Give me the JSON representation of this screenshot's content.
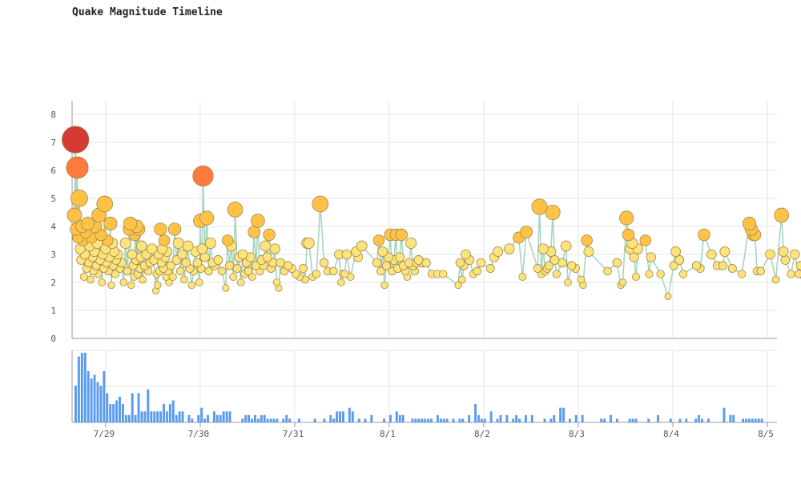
{
  "title": "Quake Magnitude Timeline",
  "colors": {
    "grid": "#e6e6e6",
    "axis": "#999999",
    "line": "#a8d5bf",
    "histogram": "#5b9bef",
    "mag_low": "#ffe27a",
    "mag_mid": "#ffc247",
    "mag_high": "#ff7a3d",
    "mag_top": "#d63a34",
    "marker_stroke": "#9a8a50"
  },
  "chart_data": [
    {
      "type": "scatter",
      "title": "Quake Magnitude Timeline",
      "xlabel": "",
      "ylabel": "",
      "ylim": [
        0,
        8
      ],
      "yticks": [
        0,
        1,
        2,
        3,
        4,
        5,
        6,
        7,
        8
      ],
      "x_unit": "days",
      "xlim": [
        0,
        7.33
      ],
      "xticks": [
        {
          "x": 0.33,
          "label": "7/29"
        },
        {
          "x": 1.33,
          "label": "7/30"
        },
        {
          "x": 2.33,
          "label": "7/31"
        },
        {
          "x": 3.33,
          "label": "8/1"
        },
        {
          "x": 4.33,
          "label": "8/2"
        },
        {
          "x": 5.33,
          "label": "8/3"
        },
        {
          "x": 6.33,
          "label": "8/4"
        },
        {
          "x": 7.33,
          "label": "8/5"
        }
      ],
      "grid": true,
      "connected": true,
      "marker_size_by_magnitude": true,
      "points": [
        [
          0.0,
          4.4
        ],
        [
          0.01,
          7.1
        ],
        [
          0.02,
          3.9
        ],
        [
          0.03,
          6.1
        ],
        [
          0.04,
          3.6
        ],
        [
          0.05,
          5.0
        ],
        [
          0.06,
          3.2
        ],
        [
          0.07,
          2.8
        ],
        [
          0.08,
          4.0
        ],
        [
          0.09,
          3.5
        ],
        [
          0.1,
          2.2
        ],
        [
          0.11,
          3.0
        ],
        [
          0.12,
          3.8
        ],
        [
          0.13,
          2.5
        ],
        [
          0.14,
          4.1
        ],
        [
          0.15,
          2.7
        ],
        [
          0.16,
          3.3
        ],
        [
          0.17,
          2.1
        ],
        [
          0.18,
          3.6
        ],
        [
          0.19,
          2.9
        ],
        [
          0.2,
          2.4
        ],
        [
          0.21,
          3.1
        ],
        [
          0.22,
          4.0
        ],
        [
          0.23,
          2.6
        ],
        [
          0.24,
          3.4
        ],
        [
          0.25,
          2.3
        ],
        [
          0.26,
          4.4
        ],
        [
          0.27,
          2.8
        ],
        [
          0.28,
          3.7
        ],
        [
          0.29,
          2.0
        ],
        [
          0.3,
          3.0
        ],
        [
          0.31,
          2.5
        ],
        [
          0.32,
          4.8
        ],
        [
          0.33,
          3.2
        ],
        [
          0.34,
          2.7
        ],
        [
          0.35,
          3.5
        ],
        [
          0.36,
          2.4
        ],
        [
          0.37,
          2.9
        ],
        [
          0.38,
          4.1
        ],
        [
          0.39,
          1.9
        ],
        [
          0.4,
          3.4
        ],
        [
          0.41,
          2.6
        ],
        [
          0.42,
          3.1
        ],
        [
          0.43,
          2.3
        ],
        [
          0.44,
          2.8
        ],
        [
          0.46,
          3.0
        ],
        [
          0.48,
          2.5
        ],
        [
          0.5,
          2.7
        ],
        [
          0.52,
          2.0
        ],
        [
          0.54,
          3.4
        ],
        [
          0.56,
          2.4
        ],
        [
          0.58,
          3.9
        ],
        [
          0.59,
          4.1
        ],
        [
          0.6,
          1.9
        ],
        [
          0.61,
          3.0
        ],
        [
          0.62,
          2.6
        ],
        [
          0.63,
          2.2
        ],
        [
          0.64,
          3.7
        ],
        [
          0.65,
          2.8
        ],
        [
          0.66,
          4.0
        ],
        [
          0.67,
          2.3
        ],
        [
          0.68,
          3.9
        ],
        [
          0.69,
          2.5
        ],
        [
          0.7,
          2.9
        ],
        [
          0.71,
          3.3
        ],
        [
          0.72,
          2.1
        ],
        [
          0.74,
          2.6
        ],
        [
          0.76,
          3.0
        ],
        [
          0.78,
          2.4
        ],
        [
          0.8,
          2.7
        ],
        [
          0.82,
          3.2
        ],
        [
          0.84,
          2.8
        ],
        [
          0.86,
          1.7
        ],
        [
          0.87,
          2.3
        ],
        [
          0.88,
          1.9
        ],
        [
          0.89,
          3.0
        ],
        [
          0.9,
          2.4
        ],
        [
          0.91,
          3.9
        ],
        [
          0.92,
          2.7
        ],
        [
          0.93,
          3.2
        ],
        [
          0.94,
          2.5
        ],
        [
          0.95,
          3.5
        ],
        [
          0.96,
          2.9
        ],
        [
          0.97,
          2.2
        ],
        [
          0.98,
          3.1
        ],
        [
          0.99,
          2.4
        ],
        [
          1.0,
          2.0
        ],
        [
          1.02,
          2.6
        ],
        [
          1.04,
          2.2
        ],
        [
          1.06,
          3.9
        ],
        [
          1.08,
          2.8
        ],
        [
          1.1,
          3.4
        ],
        [
          1.12,
          2.4
        ],
        [
          1.14,
          3.0
        ],
        [
          1.16,
          2.1
        ],
        [
          1.18,
          2.7
        ],
        [
          1.2,
          3.3
        ],
        [
          1.22,
          2.5
        ],
        [
          1.24,
          1.9
        ],
        [
          1.26,
          2.4
        ],
        [
          1.28,
          3.1
        ],
        [
          1.3,
          2.7
        ],
        [
          1.32,
          2.0
        ],
        [
          1.33,
          4.2
        ],
        [
          1.34,
          2.5
        ],
        [
          1.35,
          3.2
        ],
        [
          1.36,
          5.8
        ],
        [
          1.38,
          2.9
        ],
        [
          1.4,
          4.3
        ],
        [
          1.42,
          2.4
        ],
        [
          1.44,
          3.4
        ],
        [
          1.46,
          2.7
        ],
        [
          1.48,
          2.6
        ],
        [
          1.52,
          2.8
        ],
        [
          1.56,
          2.4
        ],
        [
          1.6,
          1.8
        ],
        [
          1.62,
          3.5
        ],
        [
          1.64,
          2.6
        ],
        [
          1.66,
          3.3
        ],
        [
          1.68,
          2.2
        ],
        [
          1.7,
          4.6
        ],
        [
          1.72,
          2.5
        ],
        [
          1.74,
          2.9
        ],
        [
          1.76,
          2.0
        ],
        [
          1.78,
          3.0
        ],
        [
          1.8,
          2.3
        ],
        [
          1.82,
          2.7
        ],
        [
          1.84,
          2.4
        ],
        [
          1.86,
          2.9
        ],
        [
          1.88,
          2.2
        ],
        [
          1.9,
          3.8
        ],
        [
          1.92,
          2.6
        ],
        [
          1.94,
          4.2
        ],
        [
          1.96,
          2.4
        ],
        [
          1.98,
          2.8
        ],
        [
          2.0,
          2.6
        ],
        [
          2.02,
          3.3
        ],
        [
          2.04,
          2.9
        ],
        [
          2.06,
          3.7
        ],
        [
          2.08,
          2.5
        ],
        [
          2.1,
          2.7
        ],
        [
          2.12,
          3.2
        ],
        [
          2.14,
          2.0
        ],
        [
          2.16,
          1.8
        ],
        [
          2.18,
          2.7
        ],
        [
          2.22,
          2.4
        ],
        [
          2.26,
          2.6
        ],
        [
          2.3,
          2.5
        ],
        [
          2.34,
          2.3
        ],
        [
          2.38,
          2.2
        ],
        [
          2.42,
          2.5
        ],
        [
          2.44,
          2.1
        ],
        [
          2.46,
          3.4
        ],
        [
          2.48,
          3.4
        ],
        [
          2.52,
          2.2
        ],
        [
          2.56,
          2.3
        ],
        [
          2.6,
          4.8
        ],
        [
          2.64,
          2.7
        ],
        [
          2.68,
          2.4
        ],
        [
          2.74,
          2.4
        ],
        [
          2.8,
          3.0
        ],
        [
          2.82,
          2.0
        ],
        [
          2.84,
          2.3
        ],
        [
          2.86,
          2.3
        ],
        [
          2.88,
          3.0
        ],
        [
          2.92,
          2.2
        ],
        [
          2.98,
          3.1
        ],
        [
          3.0,
          2.9
        ],
        [
          3.04,
          3.3
        ],
        [
          3.2,
          2.7
        ],
        [
          3.22,
          3.5
        ],
        [
          3.24,
          2.4
        ],
        [
          3.26,
          3.1
        ],
        [
          3.28,
          1.9
        ],
        [
          3.3,
          2.6
        ],
        [
          3.32,
          2.9
        ],
        [
          3.34,
          3.7
        ],
        [
          3.36,
          2.4
        ],
        [
          3.38,
          2.8
        ],
        [
          3.4,
          3.7
        ],
        [
          3.42,
          2.5
        ],
        [
          3.44,
          2.9
        ],
        [
          3.46,
          3.7
        ],
        [
          3.48,
          2.6
        ],
        [
          3.5,
          2.4
        ],
        [
          3.52,
          2.2
        ],
        [
          3.54,
          2.7
        ],
        [
          3.56,
          3.4
        ],
        [
          3.58,
          2.6
        ],
        [
          3.6,
          2.4
        ],
        [
          3.62,
          2.7
        ],
        [
          3.64,
          2.8
        ],
        [
          3.68,
          2.7
        ],
        [
          3.72,
          2.7
        ],
        [
          3.78,
          2.3
        ],
        [
          3.84,
          2.3
        ],
        [
          3.9,
          2.3
        ],
        [
          4.06,
          1.9
        ],
        [
          4.08,
          2.7
        ],
        [
          4.1,
          2.1
        ],
        [
          4.12,
          2.6
        ],
        [
          4.14,
          3.0
        ],
        [
          4.18,
          2.8
        ],
        [
          4.22,
          2.3
        ],
        [
          4.26,
          2.4
        ],
        [
          4.3,
          2.7
        ],
        [
          4.4,
          2.5
        ],
        [
          4.44,
          2.9
        ],
        [
          4.48,
          3.1
        ],
        [
          4.6,
          3.2
        ],
        [
          4.7,
          3.6
        ],
        [
          4.74,
          2.2
        ],
        [
          4.78,
          3.8
        ],
        [
          4.9,
          2.5
        ],
        [
          4.92,
          4.7
        ],
        [
          4.94,
          2.3
        ],
        [
          4.96,
          3.2
        ],
        [
          4.98,
          2.4
        ],
        [
          5.0,
          2.5
        ],
        [
          5.02,
          2.6
        ],
        [
          5.04,
          3.1
        ],
        [
          5.06,
          4.5
        ],
        [
          5.08,
          2.8
        ],
        [
          5.1,
          2.3
        ],
        [
          5.16,
          2.7
        ],
        [
          5.2,
          3.3
        ],
        [
          5.22,
          2.0
        ],
        [
          5.26,
          2.6
        ],
        [
          5.3,
          2.5
        ],
        [
          5.36,
          2.1
        ],
        [
          5.38,
          1.9
        ],
        [
          5.42,
          3.5
        ],
        [
          5.44,
          3.1
        ],
        [
          5.64,
          2.4
        ],
        [
          5.74,
          2.7
        ],
        [
          5.78,
          1.9
        ],
        [
          5.8,
          2.0
        ],
        [
          5.84,
          4.3
        ],
        [
          5.86,
          3.7
        ],
        [
          5.88,
          3.2
        ],
        [
          5.9,
          3.4
        ],
        [
          5.92,
          2.9
        ],
        [
          5.94,
          2.2
        ],
        [
          5.96,
          3.2
        ],
        [
          6.04,
          3.5
        ],
        [
          6.08,
          2.3
        ],
        [
          6.1,
          2.9
        ],
        [
          6.2,
          2.3
        ],
        [
          6.28,
          1.5
        ],
        [
          6.34,
          2.6
        ],
        [
          6.36,
          3.1
        ],
        [
          6.4,
          2.8
        ],
        [
          6.44,
          2.3
        ],
        [
          6.58,
          2.6
        ],
        [
          6.62,
          2.5
        ],
        [
          6.66,
          3.7
        ],
        [
          6.74,
          3.0
        ],
        [
          6.8,
          2.6
        ],
        [
          6.86,
          2.6
        ],
        [
          6.88,
          3.1
        ],
        [
          6.96,
          2.5
        ],
        [
          7.06,
          2.3
        ],
        [
          7.14,
          4.1
        ],
        [
          7.16,
          3.9
        ],
        [
          7.18,
          3.7
        ],
        [
          7.2,
          3.7
        ],
        [
          7.22,
          2.4
        ],
        [
          7.26,
          2.4
        ],
        [
          7.36,
          3.0
        ],
        [
          7.42,
          2.1
        ],
        [
          7.48,
          4.4
        ],
        [
          7.5,
          3.1
        ],
        [
          7.52,
          2.8
        ],
        [
          7.58,
          2.3
        ],
        [
          7.62,
          3.0
        ],
        [
          7.66,
          2.3
        ],
        [
          7.68,
          2.6
        ],
        [
          7.72,
          2.2
        ],
        [
          7.76,
          2.9
        ],
        [
          7.8,
          2.2
        ],
        [
          7.84,
          2.7
        ],
        [
          7.86,
          2.6
        ]
      ]
    },
    {
      "type": "bar",
      "title": "",
      "note": "event count per bin, shares x-axis with the magnitude timeline",
      "bin_width": 0.0333,
      "x0": 0,
      "ylim": [
        0,
        20
      ],
      "values": [
        10,
        18,
        19,
        19,
        14,
        12,
        13,
        11,
        10,
        14,
        8,
        5,
        5,
        6,
        7,
        5,
        2,
        2,
        8,
        2,
        8,
        3,
        3,
        9,
        3,
        3,
        3,
        3,
        5,
        3,
        5,
        6,
        2,
        3,
        3,
        0,
        2,
        1,
        0,
        2,
        4,
        1,
        2,
        0,
        3,
        2,
        2,
        3,
        3,
        3,
        0,
        0,
        0,
        1,
        2,
        2,
        1,
        2,
        1,
        2,
        2,
        1,
        1,
        1,
        1,
        0,
        1,
        2,
        1,
        0,
        0,
        1,
        0,
        0,
        0,
        0,
        1,
        0,
        0,
        1,
        0,
        2,
        1,
        3,
        3,
        3,
        0,
        4,
        3,
        0,
        1,
        0,
        1,
        0,
        2,
        0,
        0,
        0,
        1,
        0,
        2,
        0,
        3,
        2,
        2,
        0,
        0,
        1,
        1,
        1,
        1,
        1,
        1,
        1,
        0,
        2,
        1,
        1,
        1,
        0,
        1,
        0,
        1,
        1,
        0,
        2,
        0,
        5,
        2,
        1,
        1,
        0,
        3,
        0,
        1,
        2,
        0,
        2,
        0,
        1,
        2,
        1,
        0,
        2,
        0,
        2,
        0,
        0,
        0,
        1,
        0,
        1,
        2,
        0,
        4,
        4,
        0,
        1,
        0,
        2,
        0,
        2,
        0,
        0,
        0,
        0,
        0,
        1,
        1,
        0,
        2,
        0,
        1,
        0,
        0,
        0,
        1,
        1,
        1,
        0,
        0,
        0,
        1,
        0,
        0,
        2,
        0,
        0,
        0,
        1,
        0,
        0,
        1,
        0,
        1,
        0,
        0,
        1,
        2,
        1,
        0,
        1,
        0,
        0,
        0,
        0,
        4,
        0,
        2,
        2,
        0,
        0,
        1,
        1,
        1,
        1,
        1,
        1,
        1,
        0
      ]
    }
  ]
}
